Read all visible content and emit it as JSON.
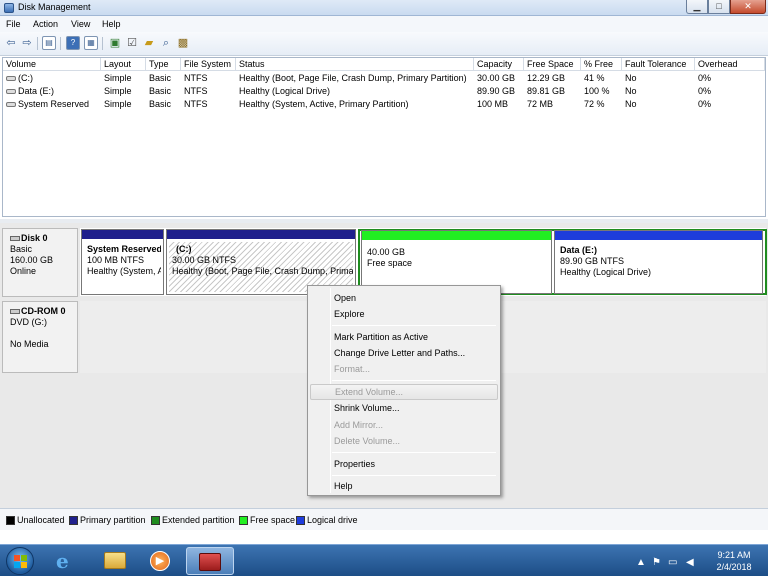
{
  "window": {
    "title": "Disk Management"
  },
  "menubar": [
    "File",
    "Action",
    "View",
    "Help"
  ],
  "volume_table": {
    "columns": [
      "Volume",
      "Layout",
      "Type",
      "File System",
      "Status",
      "Capacity",
      "Free Space",
      "% Free",
      "Fault Tolerance",
      "Overhead"
    ],
    "rows": [
      [
        "(C:)",
        "Simple",
        "Basic",
        "NTFS",
        "Healthy (Boot, Page File, Crash Dump, Primary Partition)",
        "30.00 GB",
        "12.29 GB",
        "41 %",
        "No",
        "0%"
      ],
      [
        "Data (E:)",
        "Simple",
        "Basic",
        "NTFS",
        "Healthy (Logical Drive)",
        "89.90 GB",
        "89.81 GB",
        "100 %",
        "No",
        "0%"
      ],
      [
        "System Reserved",
        "Simple",
        "Basic",
        "NTFS",
        "Healthy (System, Active, Primary Partition)",
        "100 MB",
        "72 MB",
        "72 %",
        "No",
        "0%"
      ]
    ]
  },
  "disk0": {
    "name": "Disk 0",
    "type": "Basic",
    "size": "160.00 GB",
    "status": "Online",
    "partitions": {
      "sysres": {
        "name": "System Reserved",
        "size": "100 MB NTFS",
        "status": "Healthy (System, A"
      },
      "c": {
        "name": "(C:)",
        "size": "30.00 GB NTFS",
        "status": "Healthy (Boot, Page File, Crash Dump, Primar"
      },
      "free": {
        "size": "40.00 GB",
        "status": "Free space"
      },
      "data": {
        "name": "Data  (E:)",
        "size": "89.90 GB NTFS",
        "status": "Healthy (Logical Drive)"
      }
    }
  },
  "cdrom0": {
    "name": "CD-ROM 0",
    "type": "DVD (G:)",
    "media": "No Media"
  },
  "context_menu": {
    "open": "Open",
    "explore": "Explore",
    "mark_active": "Mark Partition as Active",
    "change_letter": "Change Drive Letter and Paths...",
    "format": "Format...",
    "extend": "Extend Volume...",
    "shrink": "Shrink Volume...",
    "add_mirror": "Add Mirror...",
    "delete": "Delete Volume...",
    "properties": "Properties",
    "help": "Help"
  },
  "legend": [
    "Unallocated",
    "Primary partition",
    "Extended partition",
    "Free space",
    "Logical drive"
  ],
  "colors": {
    "unallocated": "#000000",
    "primary": "#1f1f8c",
    "extended": "#1f8c1f",
    "free": "#22ee22",
    "logical": "#1e3cdc"
  },
  "taskbar": {
    "time": "9:21 AM",
    "date": "2/4/2018"
  }
}
